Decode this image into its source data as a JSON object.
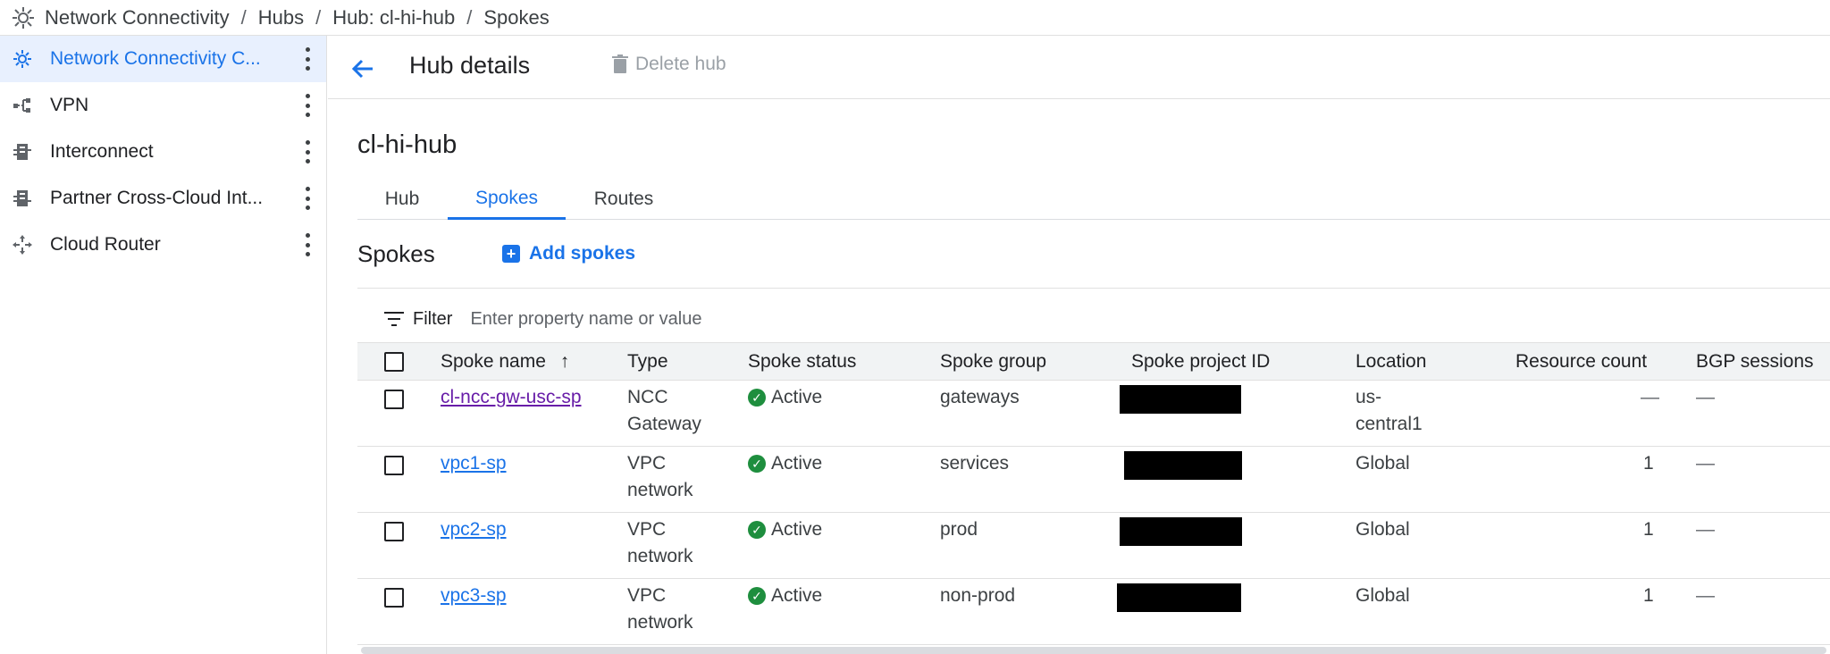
{
  "breadcrumb": {
    "items": [
      "Network Connectivity",
      "Hubs",
      "Hub: cl-hi-hub",
      "Spokes"
    ],
    "separator": "/"
  },
  "sidebar": {
    "items": [
      {
        "label": "Network Connectivity C...",
        "icon": "network-connectivity-center-icon",
        "active": true
      },
      {
        "label": "VPN",
        "icon": "vpn-icon",
        "active": false
      },
      {
        "label": "Interconnect",
        "icon": "interconnect-icon",
        "active": false
      },
      {
        "label": "Partner Cross-Cloud Int...",
        "icon": "partner-interconnect-icon",
        "active": false
      },
      {
        "label": "Cloud Router",
        "icon": "cloud-router-icon",
        "active": false
      }
    ]
  },
  "header": {
    "title": "Hub details",
    "delete_label": "Delete hub"
  },
  "hub": {
    "name": "cl-hi-hub"
  },
  "tabs": [
    {
      "label": "Hub",
      "active": false
    },
    {
      "label": "Spokes",
      "active": true
    },
    {
      "label": "Routes",
      "active": false
    }
  ],
  "spokes": {
    "title": "Spokes",
    "add_label": "Add spokes",
    "filter_label": "Filter",
    "filter_placeholder": "Enter property name or value",
    "columns": [
      "Spoke name",
      "Type",
      "Spoke status",
      "Spoke group",
      "Spoke project ID",
      "Location",
      "Resource count",
      "BGP sessions"
    ],
    "sort_indicator": "↑",
    "rows": [
      {
        "name": "cl-ncc-gw-usc-sp",
        "type_line1": "NCC",
        "type_line2": "Gateway",
        "status": "Active",
        "group": "gateways",
        "location_line1": "us-",
        "location_line2": "central1",
        "resource_count": "—",
        "bgp": "—",
        "visited": true
      },
      {
        "name": "vpc1-sp",
        "type_line1": "VPC",
        "type_line2": "network",
        "status": "Active",
        "group": "services",
        "location_line1": "Global",
        "location_line2": "",
        "resource_count": "1",
        "bgp": "—",
        "visited": false
      },
      {
        "name": "vpc2-sp",
        "type_line1": "VPC",
        "type_line2": "network",
        "status": "Active",
        "group": "prod",
        "location_line1": "Global",
        "location_line2": "",
        "resource_count": "1",
        "bgp": "—",
        "visited": false
      },
      {
        "name": "vpc3-sp",
        "type_line1": "VPC",
        "type_line2": "network",
        "status": "Active",
        "group": "non-prod",
        "location_line1": "Global",
        "location_line2": "",
        "resource_count": "1",
        "bgp": "—",
        "visited": false
      }
    ]
  },
  "colors": {
    "accent": "#1a73e8",
    "active_bg": "#e8f0fe",
    "success": "#1e8e3e",
    "visited_link": "#681da8"
  }
}
